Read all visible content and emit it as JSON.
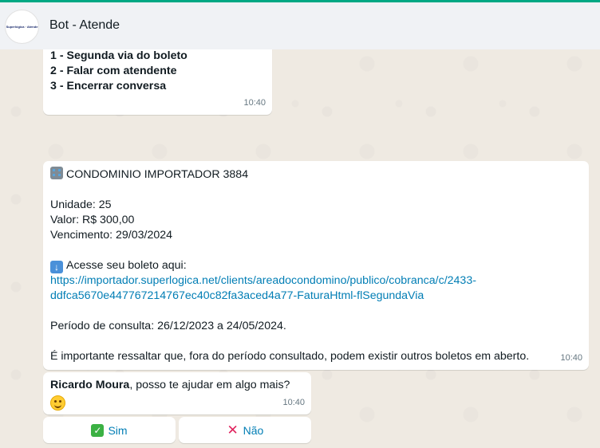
{
  "header": {
    "title": "Bot - Atende",
    "avatar_text": "Superlógica · Atende"
  },
  "menu_message": {
    "options": [
      {
        "num": "1",
        "label": "Segunda via do boleto"
      },
      {
        "num": "2",
        "label": "Falar com atendente"
      },
      {
        "num": "3",
        "label": "Encerrar conversa"
      }
    ],
    "time": "10:40"
  },
  "boleto_message": {
    "condo": "CONDOMINIO IMPORTADOR 3884",
    "unidade": "Unidade: 25",
    "valor": "Valor: R$ 300,00",
    "vencimento": "Vencimento: 29/03/2024",
    "access_text": "Acesse seu boleto aqui:",
    "link_line1": "https://importador.superlogica.net/clients/areadocondomino/publico/cobranca/c/2433-",
    "link_line2": "ddfca5670e447767214767ec40c82fa3aced4a77-FaturaHtml-flSegundaVia",
    "periodo": "Período de consulta: 26/12/2023 a 24/05/2024.",
    "aviso": "É importante ressaltar que, fora do período consultado, podem existir outros boletos em aberto.",
    "time": "10:40",
    "icons": {
      "condo": "office-building-emoji",
      "access": "down-arrow-emoji"
    }
  },
  "help_message": {
    "name": "Ricardo Moura",
    "text": ", posso te ajudar em algo mais?",
    "time": "10:40",
    "emoji": "smiling-face-emoji"
  },
  "buttons": {
    "sim": "Sim",
    "nao": "Não",
    "sim_icon": "check-mark-button-emoji",
    "nao_icon": "cross-mark-emoji"
  },
  "colors": {
    "accent": "#00a884",
    "link": "#027eb5",
    "chat_bg": "#efeae2",
    "header_bg": "#f0f2f5"
  }
}
